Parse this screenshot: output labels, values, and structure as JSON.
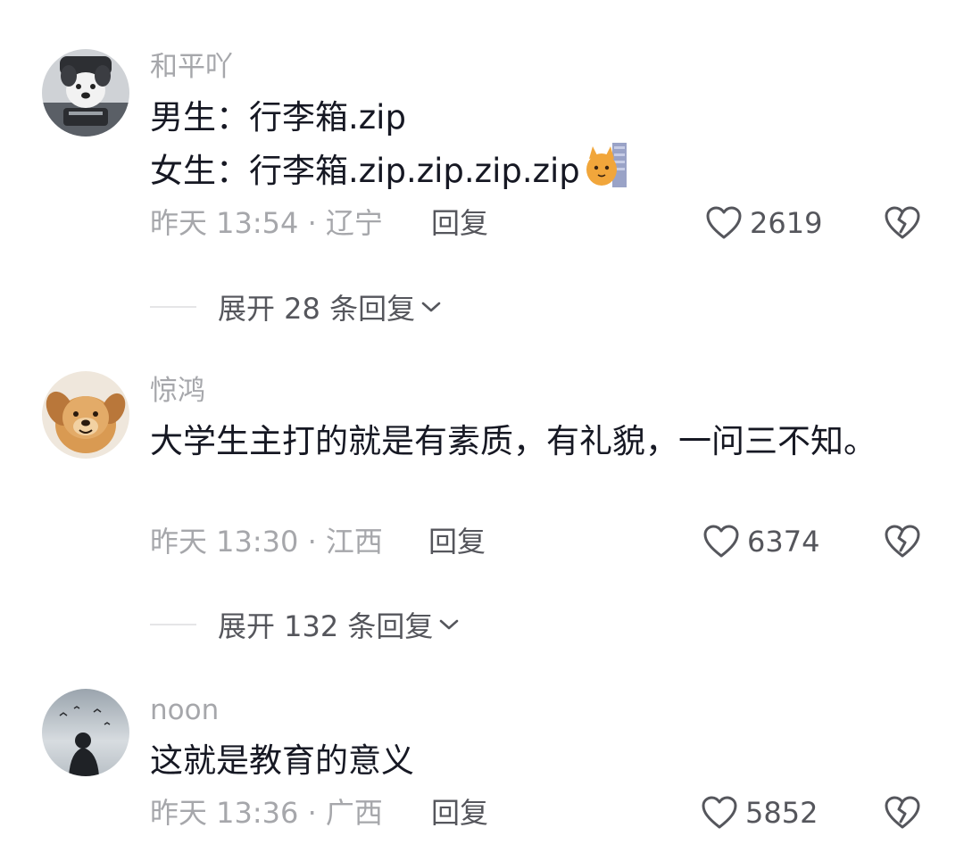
{
  "comments": [
    {
      "username": "和平吖",
      "avatar_icon": "dog-avatar-icon",
      "content_lines": [
        "男生：行李箱.zip",
        "女生：行李箱.zip.zip.zip.zip"
      ],
      "emoji": "cat-emoji-icon",
      "meta": "昨天 13:54 · 辽宁",
      "reply_label": "回复",
      "likes": "2619",
      "expand_label": "展开 28 条回复"
    },
    {
      "username": "惊鸿",
      "avatar_icon": "puppy-avatar-icon",
      "content": "大学生主打的就是有素质，有礼貌，一问三不知。",
      "meta": "昨天 13:30 · 江西",
      "reply_label": "回复",
      "likes": "6374",
      "expand_label": "展开 132 条回复"
    },
    {
      "username": "noon",
      "avatar_icon": "silhouette-avatar-icon",
      "content": "这就是教育的意义",
      "meta": "昨天 13:36 · 广西",
      "reply_label": "回复",
      "likes": "5852"
    }
  ],
  "colors": {
    "text_primary": "#161823",
    "text_secondary": "#a6a7ab",
    "text_action": "#55565c",
    "divider": "#e5e5e7"
  }
}
